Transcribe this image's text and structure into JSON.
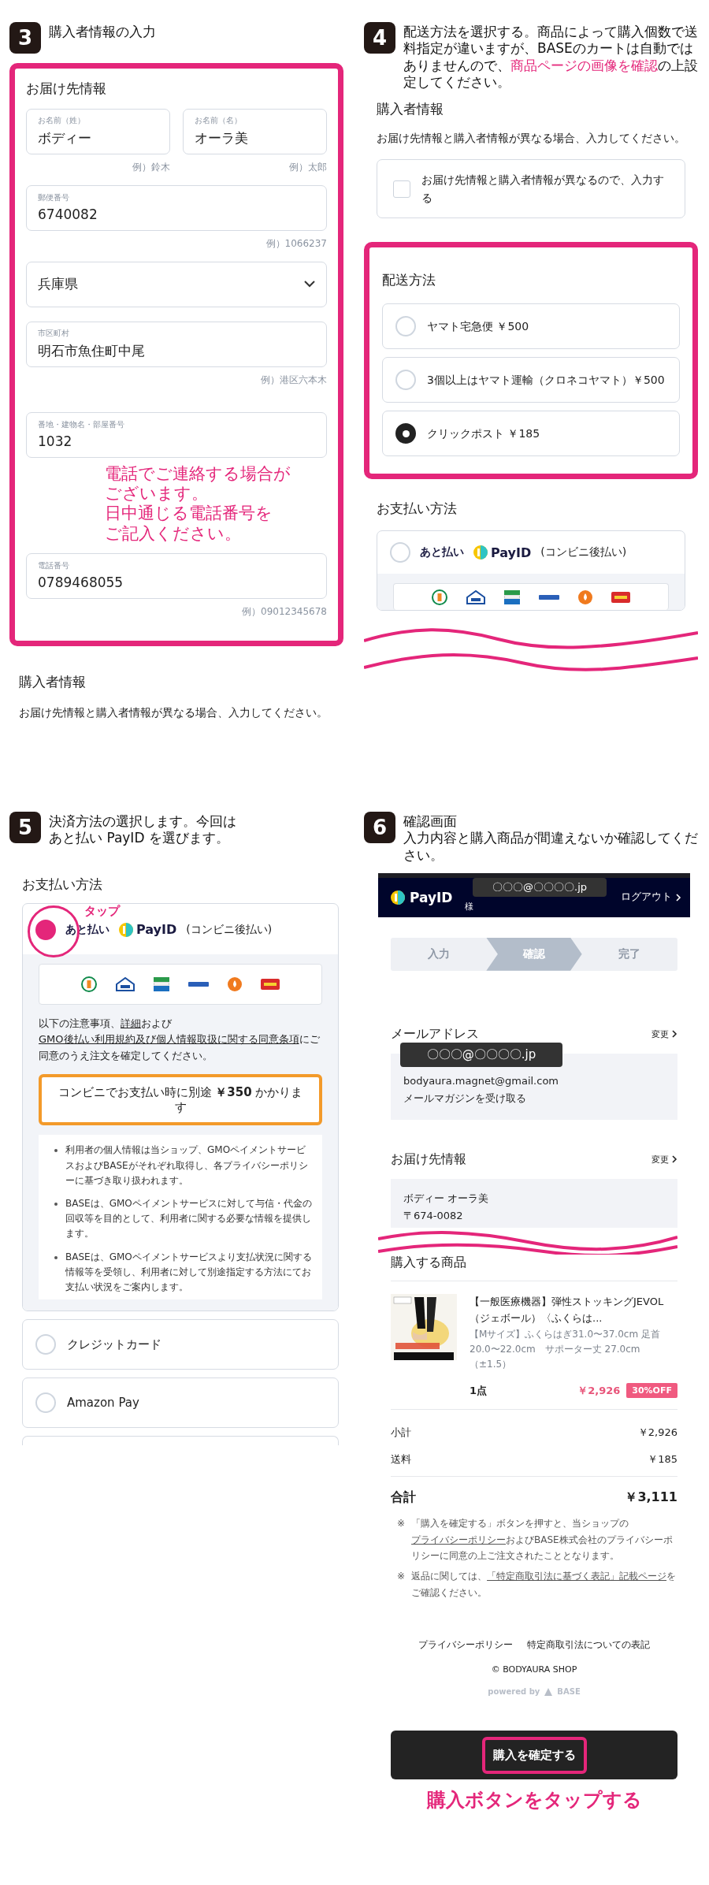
{
  "step3": {
    "number": "3",
    "caption": "購入者情報の入力",
    "section_title": "お届け先情報",
    "name_fields": [
      {
        "label": "お名前（姓）",
        "value": "ボディー",
        "example": "例）鈴木"
      },
      {
        "label": "お名前（名）",
        "value": "オーラ美",
        "example": "例）太郎"
      }
    ],
    "fields": [
      {
        "kind": "text",
        "label": "郵便番号",
        "value": "6740082",
        "example": "例）1066237"
      },
      {
        "kind": "select",
        "value": "兵庫県"
      },
      {
        "kind": "text",
        "label": "市区町村",
        "value": "明石市魚住町中尾",
        "example": "例）港区六本木"
      },
      {
        "kind": "text",
        "label": "番地・建物名・部屋番号",
        "value": "1032"
      },
      {
        "kind": "text",
        "label": "電話番号",
        "value": "0789468055",
        "example": "例）09012345678"
      }
    ],
    "note_lines": [
      "電話でご連絡する場合が",
      "ございます。",
      "日中通じる電話番号を",
      "ご記入ください。"
    ],
    "buyer_title": "購入者情報",
    "buyer_text": "お届け先情報と購入者情報が異なる場合、入力してください。"
  },
  "step4": {
    "number": "4",
    "caption_before": "配送方法を選択する。商品によって購入個数で送料指定が違いますが、BASEのカートは自動ではありませんので、",
    "caption_highlight": "商品ページの画像を確認",
    "caption_after": "の上設定してください。",
    "buyer_title": "購入者情報",
    "buyer_text": "お届け先情報と購入者情報が異なる場合、入力してください。",
    "different_buyer": {
      "label": "お届け先情報と購入者情報が異なるので、入力する",
      "checked": false
    },
    "shipping_title": "配送方法",
    "shipping_options": [
      {
        "label": "ヤマト宅急便 ￥500",
        "selected": false
      },
      {
        "label": "3個以上はヤマト運輸（クロネコヤマト）￥500",
        "selected": false
      },
      {
        "label": "クリックポスト ￥185",
        "selected": true
      }
    ],
    "payment_title": "お支払い方法",
    "payment_option": {
      "prefix": "あと払い",
      "name": "PayID",
      "suffix": "(コンビニ後払い)",
      "selected": false
    }
  },
  "step5": {
    "number": "5",
    "caption_lines": [
      "決済方法の選択します。今回は",
      "あと払い PayID を選びます。"
    ],
    "payment_title": "お支払い方法",
    "options": [
      {
        "kind": "payid",
        "prefix": "あと払い",
        "name": "PayID",
        "suffix": "(コンビニ後払い)",
        "selected": true,
        "tap_label": "タップ",
        "notice": [
          {
            "kind": "text",
            "text": "以下の注意事項、"
          },
          {
            "kind": "link",
            "text": "詳細"
          },
          {
            "kind": "text",
            "text": "および"
          },
          {
            "kind": "link",
            "text": "GMO後払い利用規約及び個人情報取扱に関する同意条項"
          },
          {
            "kind": "text",
            "text": "にご同意のうえ注文を確定してください。"
          }
        ],
        "fee_notice": "コンビニでお支払い時に別途 **￥350** かかります",
        "bullets": [
          "利用者の個人情報は当ショップ、GMOペイメントサービスおよびBASEがそれぞれ取得し、各プライバシーポリシーに基づき取り扱われます。",
          "BASEは、GMOペイメントサービスに対して与信・代金の回収等を目的として、利用者に関する必要な情報を提供します。",
          "BASEは、GMOペイメントサービスより支払状況に関する情報等を受領し、利用者に対して別途指定する方法にてお支払い状況をご案内します。"
        ]
      },
      {
        "kind": "plain",
        "label": "クレジットカード",
        "selected": false
      },
      {
        "kind": "plain",
        "label": "Amazon Pay",
        "selected": false
      }
    ]
  },
  "step6": {
    "number": "6",
    "caption_lines": [
      "確認画面",
      "入力内容と購入商品が間違えないか確認してください。"
    ],
    "header": {
      "brand": "PayID",
      "email_mask": "〇〇〇@〇〇〇〇.jp",
      "honorific": "様",
      "logout": "ログアウト"
    },
    "progress": [
      {
        "label": "入力",
        "selected": false
      },
      {
        "label": "確認",
        "selected": true
      },
      {
        "label": "完了",
        "selected": false
      }
    ],
    "email_section": {
      "title": "メールアドレス",
      "change": "変更",
      "mask": "〇〇〇@〇〇〇〇.jp",
      "lines": [
        "bodyaura.magnet@gmail.com",
        "メールマガジンを受け取る"
      ]
    },
    "address_section": {
      "title": "お届け先情報",
      "change": "変更",
      "lines": [
        "ボディー オーラ美",
        "〒674-0082"
      ]
    },
    "items_title": "購入する商品",
    "product": {
      "title": "【一般医療機器】弾性ストッキングJEVOL（ジェボール）〈ふくらは...",
      "variant": "【Mサイズ】ふくらはぎ31.0〜37.0cm 足首20.0〜22.0cm　サポーター丈 27.0cm（±1.5）",
      "quantity": "1点",
      "price": "￥2,926",
      "discount": "30%OFF"
    },
    "totals": [
      {
        "label": "小計",
        "value": "￥2,926"
      },
      {
        "label": "送料",
        "value": "￥185"
      }
    ],
    "grand_total": {
      "label": "合計",
      "value": "￥3,111"
    },
    "notes": [
      {
        "mark": "※",
        "parts": [
          {
            "kind": "text",
            "text": "「購入を確定する」ボタンを押すと、当ショップの"
          },
          {
            "kind": "link",
            "text": "プライバシーポリシー"
          },
          {
            "kind": "text",
            "text": "およびBASE株式会社のプライバシーポリシーに同意の上ご注文されたこととなります。"
          }
        ]
      },
      {
        "mark": "※",
        "parts": [
          {
            "kind": "text",
            "text": "返品に関しては、"
          },
          {
            "kind": "link",
            "text": "「特定商取引法に基づく表記」記載ページ"
          },
          {
            "kind": "text",
            "text": "をご確認ください。"
          }
        ]
      }
    ],
    "footer_links": [
      "プライバシーポリシー",
      "特定商取引法についての表記"
    ],
    "copyright": "© BODYAURA SHOP",
    "powered_by": "powered by",
    "powered_brand": "BASE",
    "confirm_button": "購入を確定する",
    "instruction": "購入ボタンをタップする"
  }
}
